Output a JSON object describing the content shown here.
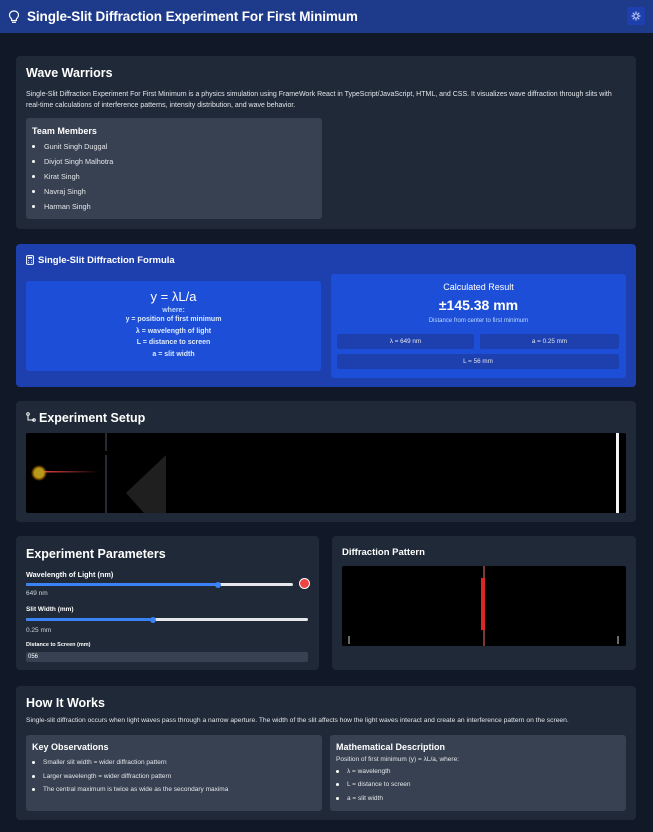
{
  "header": {
    "title": "Single-Slit Diffraction Experiment For First Minimum",
    "icon": "lightbulb-icon",
    "settings_icon": "gear-icon"
  },
  "team": {
    "name": "Wave Warriors",
    "description": "Single-Slit Diffraction Experiment For First Minimum is a physics simulation using FrameWork React in TypeScript/JavaScript, HTML, and CSS. It visualizes wave diffraction through slits with real-time calculations of interference patterns, intensity distribution, and wave behavior.",
    "members_title": "Team Members",
    "members": [
      "Gunit Singh Duggal",
      "Divjot Singh Malhotra",
      "Kirat Singh",
      "Navraj Singh",
      "Harman Singh"
    ]
  },
  "formula": {
    "title": "Single-Slit Diffraction Formula",
    "icon": "calculator-icon",
    "equation": "y = λL/a",
    "where": "where:",
    "defs": [
      "y = position of first minimum",
      "λ = wavelength of light",
      "L = distance to screen",
      "a = slit width"
    ],
    "result_title": "Calculated Result",
    "result_value": "±145.38 mm",
    "result_caption": "Distance from center to first minimum",
    "chips": [
      "λ = 649 nm",
      "a = 0.25 mm",
      "L = 56 mm"
    ]
  },
  "setup": {
    "title": "Experiment Setup",
    "icon": "flask-icon"
  },
  "params": {
    "title": "Experiment Parameters",
    "wavelength_label": "Wavelength of Light (nm)",
    "wavelength_value": "649 nm",
    "wavelength_fraction": 0.72,
    "color_swatch": "#ef4444",
    "slit_label": "Slit Width (mm)",
    "slit_value": "0.25 mm",
    "slit_fraction": 0.45,
    "distance_label": "Distance to Screen (mm)",
    "distance_value": "056"
  },
  "pattern": {
    "title": "Diffraction Pattern",
    "color": "#dc2626"
  },
  "how": {
    "title": "How It Works",
    "text": "Single-slit diffraction occurs when light waves pass through a narrow aperture. The width of the slit affects how the light waves interact and create an interference pattern on the screen.",
    "obs_title": "Key Observations",
    "observations": [
      "Smaller slit width = wider diffraction pattern",
      "Larger wavelength = wider diffraction pattern",
      "The central maximum is twice as wide as the secondary maxima"
    ],
    "math_title": "Mathematical Description",
    "math_intro": "Position of first minimum (y) = λL/a, where:",
    "math_items": [
      "λ = wavelength",
      "L = distance to screen",
      "a = slit width"
    ]
  }
}
